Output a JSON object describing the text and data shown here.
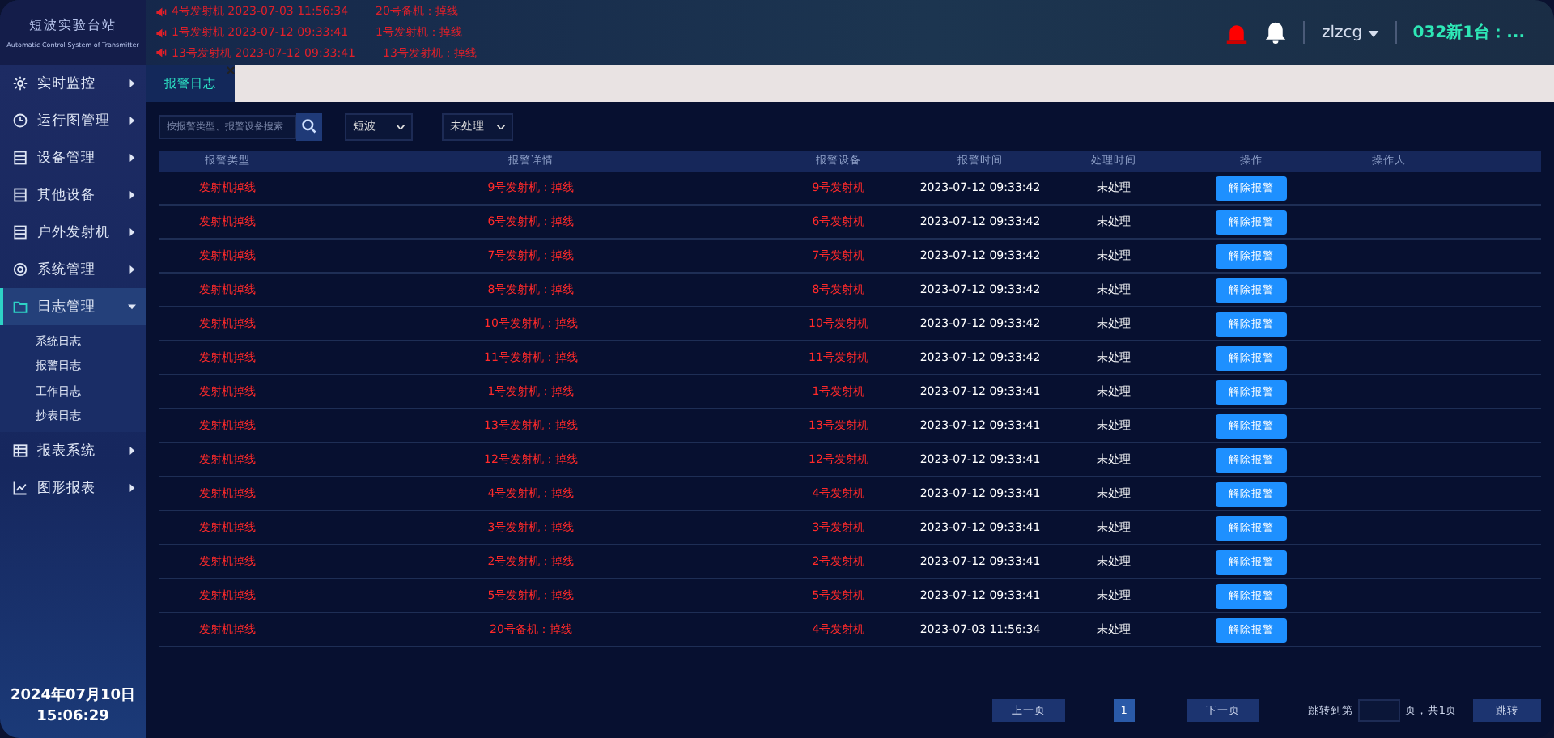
{
  "header": {
    "logo_title": "短波实验台站",
    "logo_subtitle": "Automatic Control System of Transmitter",
    "alerts": [
      {
        "source": "4号发射机 2023-07-03 11:56:34",
        "message": "20号备机：掉线"
      },
      {
        "source": "1号发射机 2023-07-12 09:33:41",
        "message": "1号发射机：掉线"
      },
      {
        "source": "13号发射机 2023-07-12 09:33:41",
        "message": "13号发射机：掉线"
      }
    ],
    "user": "zlzcg",
    "station": "032新1台：..."
  },
  "sidebar": {
    "items": [
      {
        "label": "实时监控",
        "kind": "gear",
        "selected": false,
        "expanded": false
      },
      {
        "label": "运行图管理",
        "kind": "clock",
        "selected": false,
        "expanded": false
      },
      {
        "label": "设备管理",
        "kind": "device",
        "selected": false,
        "expanded": false
      },
      {
        "label": "其他设备",
        "kind": "device",
        "selected": false,
        "expanded": false
      },
      {
        "label": "户外发射机",
        "kind": "device",
        "selected": false,
        "expanded": false
      },
      {
        "label": "系统管理",
        "kind": "cog",
        "selected": false,
        "expanded": false
      },
      {
        "label": "日志管理",
        "kind": "folder",
        "selected": true,
        "expanded": true,
        "children": [
          {
            "label": "系统日志"
          },
          {
            "label": "报警日志"
          },
          {
            "label": "工作日志"
          },
          {
            "label": "抄表日志"
          }
        ]
      },
      {
        "label": "报表系统",
        "kind": "table",
        "selected": false,
        "expanded": false
      },
      {
        "label": "图形报表",
        "kind": "chart",
        "selected": false,
        "expanded": false
      }
    ],
    "date": "2024年07月10日",
    "time": "15:06:29"
  },
  "tabs": [
    {
      "label": "报警日志",
      "selected": true
    }
  ],
  "filters": {
    "search_placeholder": "按报警类型、报警设备搜索",
    "band": "短波",
    "status": "未处理"
  },
  "table": {
    "columns": [
      "报警类型",
      "报警详情",
      "报警设备",
      "报警时间",
      "处理时间",
      "操作",
      "操作人"
    ],
    "rows": [
      {
        "type": "发射机掉线",
        "detail": "9号发射机：掉线",
        "device": "9号发射机",
        "time": "2023-07-12 09:33:42",
        "handled": "未处理",
        "action": "解除报警"
      },
      {
        "type": "发射机掉线",
        "detail": "6号发射机：掉线",
        "device": "6号发射机",
        "time": "2023-07-12 09:33:42",
        "handled": "未处理",
        "action": "解除报警"
      },
      {
        "type": "发射机掉线",
        "detail": "7号发射机：掉线",
        "device": "7号发射机",
        "time": "2023-07-12 09:33:42",
        "handled": "未处理",
        "action": "解除报警"
      },
      {
        "type": "发射机掉线",
        "detail": "8号发射机：掉线",
        "device": "8号发射机",
        "time": "2023-07-12 09:33:42",
        "handled": "未处理",
        "action": "解除报警"
      },
      {
        "type": "发射机掉线",
        "detail": "10号发射机：掉线",
        "device": "10号发射机",
        "time": "2023-07-12 09:33:42",
        "handled": "未处理",
        "action": "解除报警"
      },
      {
        "type": "发射机掉线",
        "detail": "11号发射机：掉线",
        "device": "11号发射机",
        "time": "2023-07-12 09:33:42",
        "handled": "未处理",
        "action": "解除报警"
      },
      {
        "type": "发射机掉线",
        "detail": "1号发射机：掉线",
        "device": "1号发射机",
        "time": "2023-07-12 09:33:41",
        "handled": "未处理",
        "action": "解除报警"
      },
      {
        "type": "发射机掉线",
        "detail": "13号发射机：掉线",
        "device": "13号发射机",
        "time": "2023-07-12 09:33:41",
        "handled": "未处理",
        "action": "解除报警"
      },
      {
        "type": "发射机掉线",
        "detail": "12号发射机：掉线",
        "device": "12号发射机",
        "time": "2023-07-12 09:33:41",
        "handled": "未处理",
        "action": "解除报警"
      },
      {
        "type": "发射机掉线",
        "detail": "4号发射机：掉线",
        "device": "4号发射机",
        "time": "2023-07-12 09:33:41",
        "handled": "未处理",
        "action": "解除报警"
      },
      {
        "type": "发射机掉线",
        "detail": "3号发射机：掉线",
        "device": "3号发射机",
        "time": "2023-07-12 09:33:41",
        "handled": "未处理",
        "action": "解除报警"
      },
      {
        "type": "发射机掉线",
        "detail": "2号发射机：掉线",
        "device": "2号发射机",
        "time": "2023-07-12 09:33:41",
        "handled": "未处理",
        "action": "解除报警"
      },
      {
        "type": "发射机掉线",
        "detail": "5号发射机：掉线",
        "device": "5号发射机",
        "time": "2023-07-12 09:33:41",
        "handled": "未处理",
        "action": "解除报警"
      },
      {
        "type": "发射机掉线",
        "detail": "20号备机：掉线",
        "device": "4号发射机",
        "time": "2023-07-03 11:56:34",
        "handled": "未处理",
        "action": "解除报警"
      }
    ]
  },
  "pagination": {
    "prev": "上一页",
    "pages": [
      {
        "label": "1",
        "selected": true
      }
    ],
    "next": "下一页",
    "goto_label": "跳转到第",
    "total": "页，共1页",
    "go": "跳转"
  }
}
